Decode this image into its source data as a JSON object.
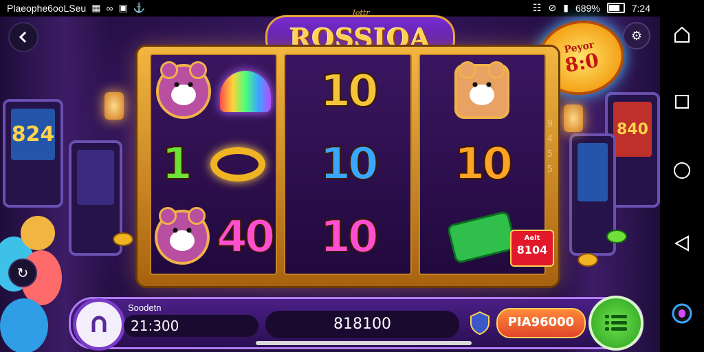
{
  "status_bar": {
    "left_text": "Plaeophe6ooLSeu",
    "left_icons": [
      "grid-icon",
      "infinity-icon",
      "instagram-icon",
      "anchor-icon"
    ],
    "right_icons": [
      "vibrate-icon",
      "no-signal-icon",
      "signal-icon"
    ],
    "battery_text": "689%",
    "time": "7:24"
  },
  "game": {
    "subtitle": "Jottr",
    "title": "ROSSIOA",
    "jackpot": {
      "line1": "Peyor",
      "line2": "8:0"
    },
    "reels": [
      [
        "bear-icon",
        "bell-icon",
        "1",
        "ring-icon",
        "bear-icon",
        "40"
      ],
      [
        "10",
        "10",
        "10"
      ],
      [
        "cat-icon",
        "10",
        "cash-icon"
      ]
    ],
    "side_digits": [
      "9",
      "4",
      "5",
      "5"
    ],
    "bet_badge": {
      "line1": "Aelt",
      "line2": "8104"
    },
    "balance_label": "Soodetn",
    "balance_value": "21:300",
    "win_value": "818100",
    "play_label": "PIA96000",
    "arcade_left_screen": "824",
    "arcade_right_screen": "840",
    "colors": {
      "gold": "#f4c33a",
      "purple": "#4a1f86",
      "green": "#6fe03a",
      "orange": "#ff8a3a"
    }
  },
  "nav_bar": {
    "buttons": [
      "home-icon",
      "square-icon",
      "circle-icon",
      "triangle-back-icon",
      "assistant-icon"
    ]
  }
}
